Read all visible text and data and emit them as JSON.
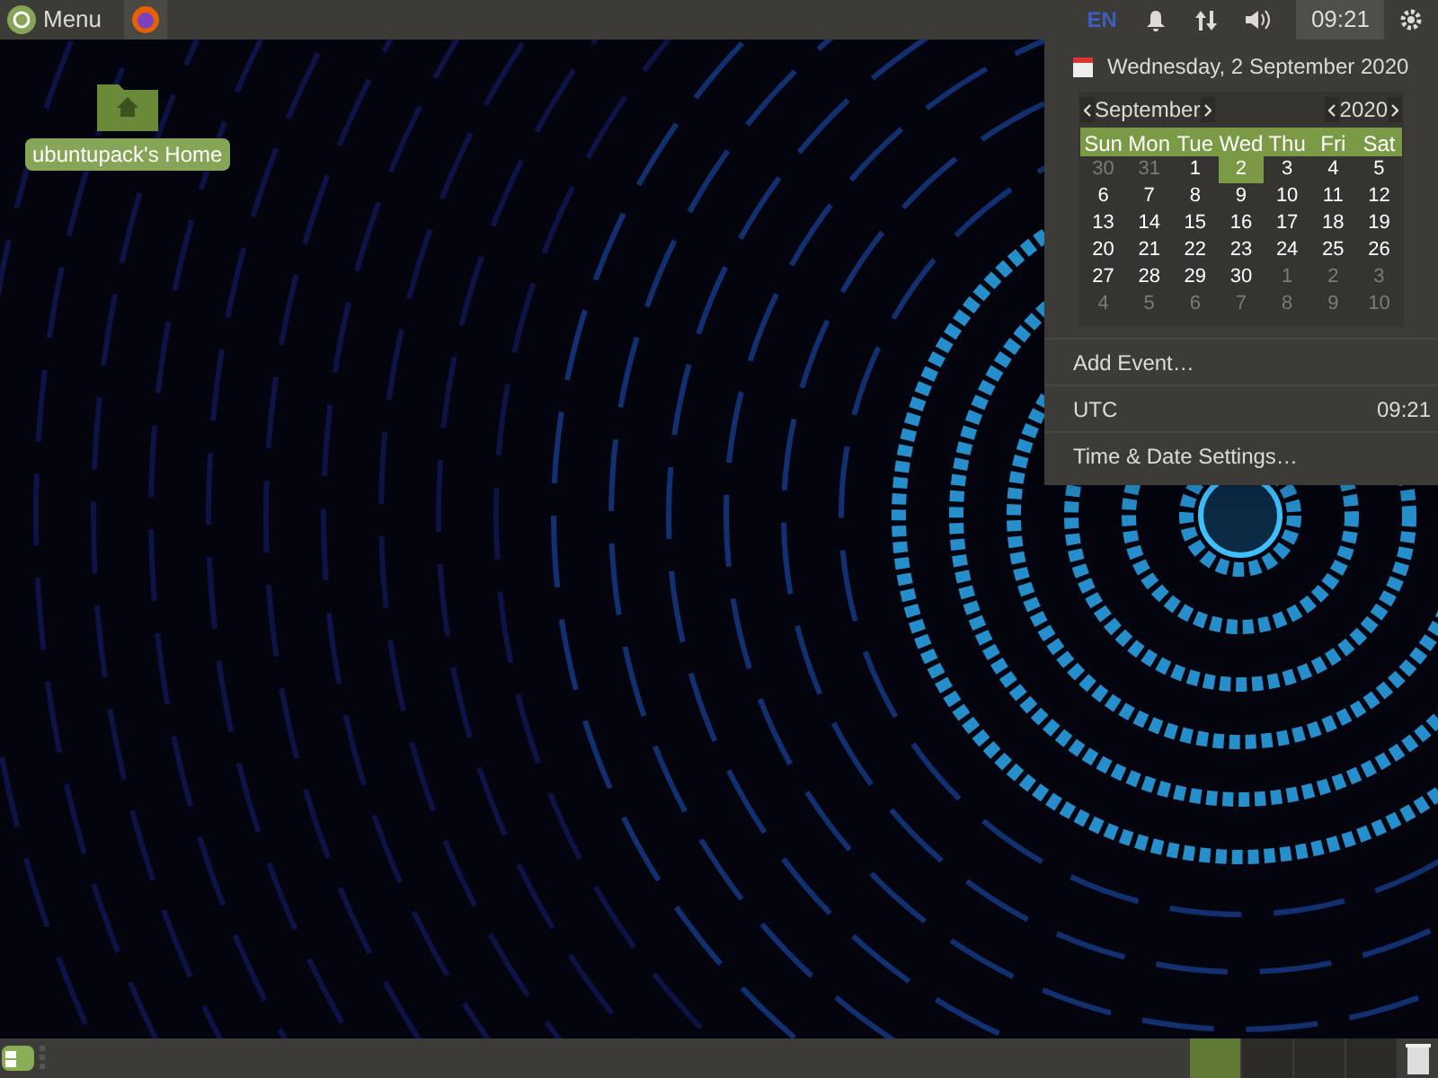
{
  "top_panel": {
    "menu_label": "Menu",
    "keyboard_layout": "EN",
    "clock": "09:21"
  },
  "desktop_icons": [
    {
      "label": "ubuntupack's Home"
    }
  ],
  "calendar_popup": {
    "date_heading": "Wednesday, 2 September 2020",
    "month": "September",
    "year": "2020",
    "weekdays": [
      "Sun",
      "Mon",
      "Tue",
      "Wed",
      "Thu",
      "Fri",
      "Sat"
    ],
    "weeks": [
      [
        {
          "label": "30",
          "other_month": true,
          "selected": false
        },
        {
          "label": "31",
          "other_month": true,
          "selected": false
        },
        {
          "label": "1",
          "other_month": false,
          "selected": false
        },
        {
          "label": "2",
          "other_month": false,
          "selected": true
        },
        {
          "label": "3",
          "other_month": false,
          "selected": false
        },
        {
          "label": "4",
          "other_month": false,
          "selected": false
        },
        {
          "label": "5",
          "other_month": false,
          "selected": false
        }
      ],
      [
        {
          "label": "6",
          "other_month": false,
          "selected": false
        },
        {
          "label": "7",
          "other_month": false,
          "selected": false
        },
        {
          "label": "8",
          "other_month": false,
          "selected": false
        },
        {
          "label": "9",
          "other_month": false,
          "selected": false
        },
        {
          "label": "10",
          "other_month": false,
          "selected": false
        },
        {
          "label": "11",
          "other_month": false,
          "selected": false
        },
        {
          "label": "12",
          "other_month": false,
          "selected": false
        }
      ],
      [
        {
          "label": "13",
          "other_month": false,
          "selected": false
        },
        {
          "label": "14",
          "other_month": false,
          "selected": false
        },
        {
          "label": "15",
          "other_month": false,
          "selected": false
        },
        {
          "label": "16",
          "other_month": false,
          "selected": false
        },
        {
          "label": "17",
          "other_month": false,
          "selected": false
        },
        {
          "label": "18",
          "other_month": false,
          "selected": false
        },
        {
          "label": "19",
          "other_month": false,
          "selected": false
        }
      ],
      [
        {
          "label": "20",
          "other_month": false,
          "selected": false
        },
        {
          "label": "21",
          "other_month": false,
          "selected": false
        },
        {
          "label": "22",
          "other_month": false,
          "selected": false
        },
        {
          "label": "23",
          "other_month": false,
          "selected": false
        },
        {
          "label": "24",
          "other_month": false,
          "selected": false
        },
        {
          "label": "25",
          "other_month": false,
          "selected": false
        },
        {
          "label": "26",
          "other_month": false,
          "selected": false
        }
      ],
      [
        {
          "label": "27",
          "other_month": false,
          "selected": false
        },
        {
          "label": "28",
          "other_month": false,
          "selected": false
        },
        {
          "label": "29",
          "other_month": false,
          "selected": false
        },
        {
          "label": "30",
          "other_month": false,
          "selected": false
        },
        {
          "label": "1",
          "other_month": true,
          "selected": false
        },
        {
          "label": "2",
          "other_month": true,
          "selected": false
        },
        {
          "label": "3",
          "other_month": true,
          "selected": false
        }
      ],
      [
        {
          "label": "4",
          "other_month": true,
          "selected": false
        },
        {
          "label": "5",
          "other_month": true,
          "selected": false
        },
        {
          "label": "6",
          "other_month": true,
          "selected": false
        },
        {
          "label": "7",
          "other_month": true,
          "selected": false
        },
        {
          "label": "8",
          "other_month": true,
          "selected": false
        },
        {
          "label": "9",
          "other_month": true,
          "selected": false
        },
        {
          "label": "10",
          "other_month": true,
          "selected": false
        }
      ]
    ],
    "add_event": "Add Event…",
    "timezone": {
      "name": "UTC",
      "time": "09:21"
    },
    "settings": "Time & Date Settings…"
  },
  "workspaces": [
    {
      "selected": true
    },
    {
      "selected": false
    },
    {
      "selected": false
    },
    {
      "selected": false
    }
  ]
}
